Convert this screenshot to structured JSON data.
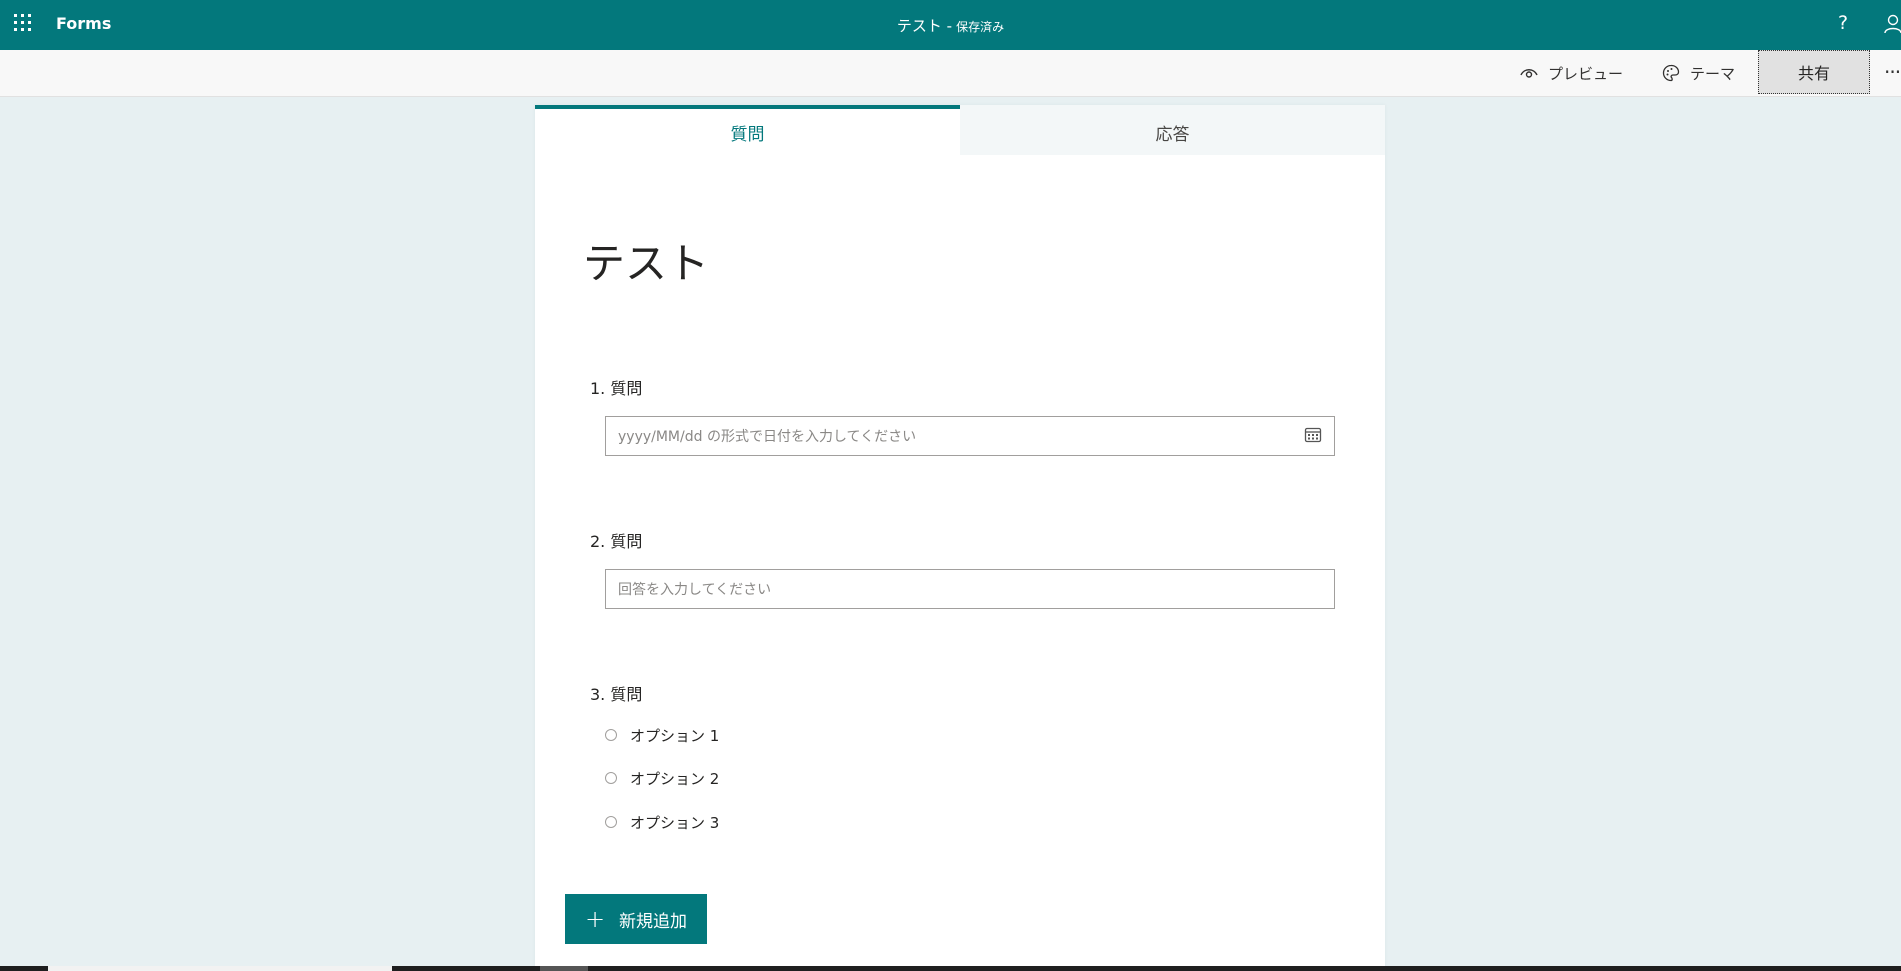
{
  "header": {
    "app_name": "Forms",
    "doc_title": "テスト -",
    "saved_status": "保存済み",
    "help_label": "?"
  },
  "commandbar": {
    "preview_label": "プレビュー",
    "theme_label": "テーマ",
    "share_label": "共有",
    "more_label": "···"
  },
  "tabs": [
    {
      "label": "質問",
      "active": true
    },
    {
      "label": "応答",
      "active": false
    }
  ],
  "form": {
    "title": "テスト",
    "questions": [
      {
        "label": "1. 質問",
        "type": "date",
        "placeholder": "yyyy/MM/dd の形式で日付を入力してください"
      },
      {
        "label": "2. 質問",
        "type": "text",
        "placeholder": "回答を入力してください"
      },
      {
        "label": "3. 質問",
        "type": "choice",
        "options": [
          "オプション 1",
          "オプション 2",
          "オプション 3"
        ]
      }
    ],
    "add_new_label": "新規追加",
    "add_new_symbol": "+"
  },
  "colors": {
    "brand": "#03787c",
    "background": "#e7f0f2"
  },
  "icons": [
    "app-launcher-icon",
    "help-icon",
    "user-icon",
    "eye-icon",
    "palette-icon",
    "calendar-icon",
    "plus-icon"
  ]
}
